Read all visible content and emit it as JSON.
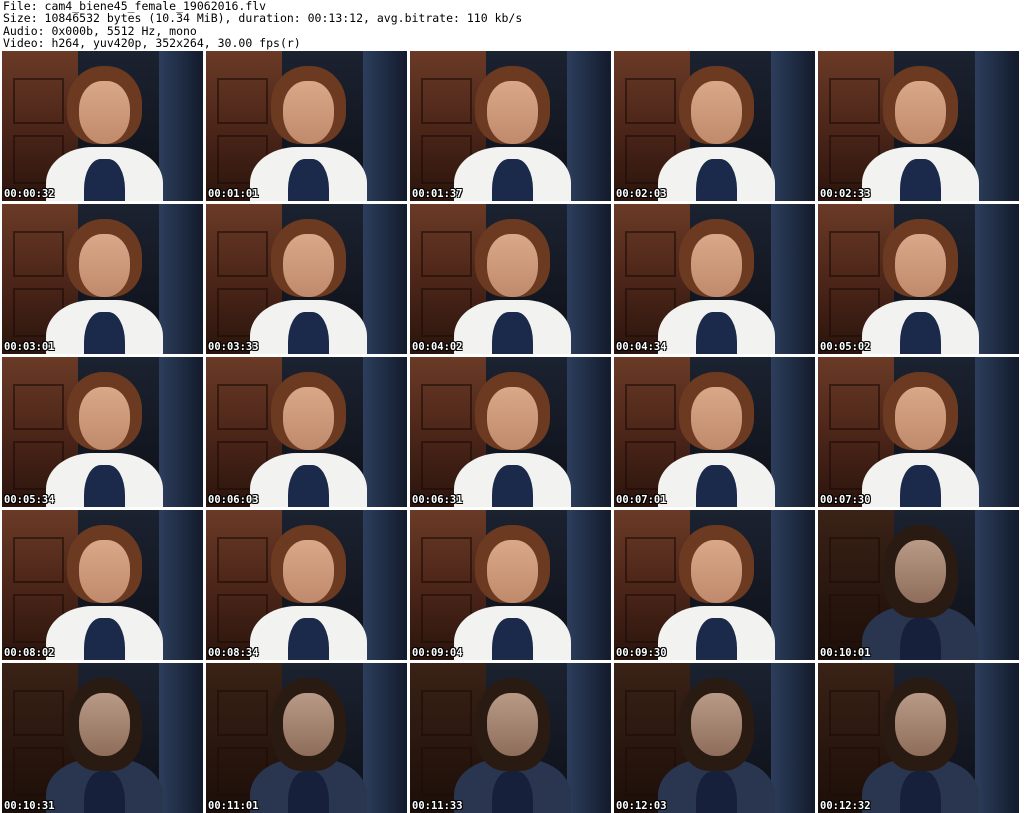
{
  "header": {
    "line1": "File: cam4_biene45_female_19062016.flv",
    "line2": "Size: 10846532 bytes (10.34 MiB), duration: 00:13:12, avg.bitrate: 110 kb/s",
    "line3": "Audio: 0x000b, 5512 Hz, mono",
    "line4": "Video: h264, yuv420p, 352x264, 30.00 fps(r)"
  },
  "thumbnails": [
    {
      "time": "00:00:32",
      "variant": "light"
    },
    {
      "time": "00:01:01",
      "variant": "light"
    },
    {
      "time": "00:01:37",
      "variant": "light"
    },
    {
      "time": "00:02:03",
      "variant": "light"
    },
    {
      "time": "00:02:33",
      "variant": "light"
    },
    {
      "time": "00:03:01",
      "variant": "light"
    },
    {
      "time": "00:03:33",
      "variant": "light"
    },
    {
      "time": "00:04:02",
      "variant": "light"
    },
    {
      "time": "00:04:34",
      "variant": "light"
    },
    {
      "time": "00:05:02",
      "variant": "light"
    },
    {
      "time": "00:05:34",
      "variant": "light"
    },
    {
      "time": "00:06:03",
      "variant": "light"
    },
    {
      "time": "00:06:31",
      "variant": "light"
    },
    {
      "time": "00:07:01",
      "variant": "light"
    },
    {
      "time": "00:07:30",
      "variant": "light"
    },
    {
      "time": "00:08:02",
      "variant": "light"
    },
    {
      "time": "00:08:34",
      "variant": "light"
    },
    {
      "time": "00:09:04",
      "variant": "light"
    },
    {
      "time": "00:09:30",
      "variant": "light"
    },
    {
      "time": "00:10:01",
      "variant": "dark"
    },
    {
      "time": "00:10:31",
      "variant": "dark"
    },
    {
      "time": "00:11:01",
      "variant": "dark"
    },
    {
      "time": "00:11:33",
      "variant": "dark"
    },
    {
      "time": "00:12:03",
      "variant": "dark"
    },
    {
      "time": "00:12:32",
      "variant": "dark"
    }
  ]
}
